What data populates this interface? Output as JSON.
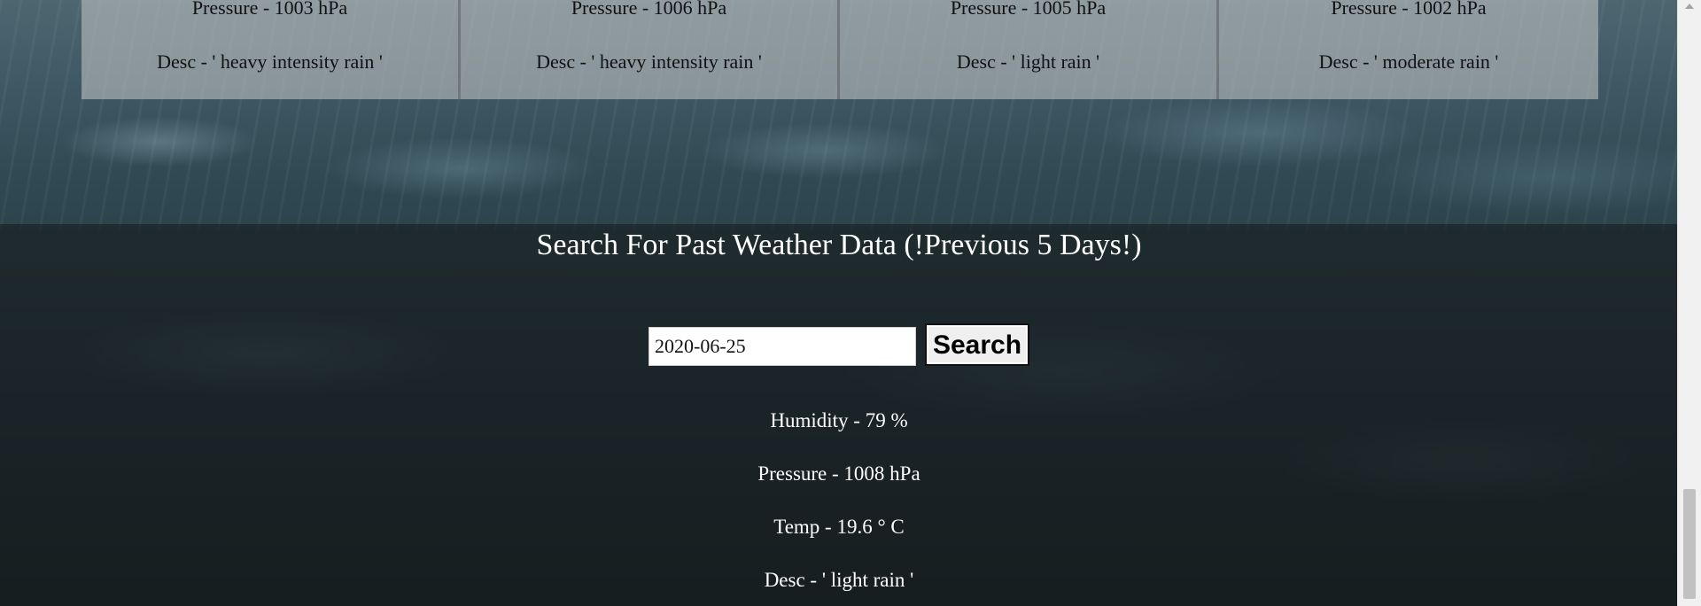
{
  "forecast_cards": [
    {
      "pressure": "Pressure - 1003 hPa",
      "desc": "Desc - ' heavy intensity rain '"
    },
    {
      "pressure": "Pressure - 1006 hPa",
      "desc": "Desc - ' heavy intensity rain '"
    },
    {
      "pressure": "Pressure - 1005 hPa",
      "desc": "Desc - ' light rain '"
    },
    {
      "pressure": "Pressure - 1002 hPa",
      "desc": "Desc - ' moderate rain '"
    }
  ],
  "search": {
    "title": "Search For Past Weather Data (!Previous 5 Days!)",
    "date_value": "2020-06-25",
    "button_label": "Search"
  },
  "result": {
    "humidity": "Humidity - 79 %",
    "pressure": "Pressure - 1008 hPa",
    "temp": "Temp - 19.6 ° C",
    "desc": "Desc - ' light rain '"
  },
  "colors": {
    "text_light": "#ffffff",
    "card_text": "#111111",
    "button_bg": "#efefef"
  }
}
